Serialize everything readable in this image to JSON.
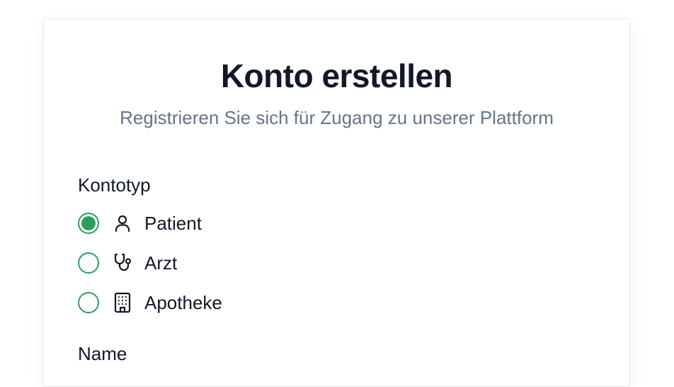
{
  "header": {
    "title": "Konto erstellen",
    "subtitle": "Registrieren Sie sich für Zugang zu unserer Plattform"
  },
  "form": {
    "account_type": {
      "label": "Kontotyp",
      "options": [
        {
          "label": "Patient",
          "icon": "user-icon",
          "selected": true
        },
        {
          "label": "Arzt",
          "icon": "stethoscope-icon",
          "selected": false
        },
        {
          "label": "Apotheke",
          "icon": "building-icon",
          "selected": false
        }
      ]
    },
    "name": {
      "label": "Name"
    }
  },
  "colors": {
    "accent": "#2f9e5b",
    "title": "#111827",
    "subtitle": "#64748b",
    "border": "#e5e7eb"
  }
}
